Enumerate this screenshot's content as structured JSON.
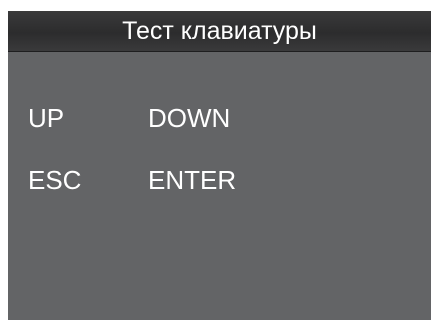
{
  "header": {
    "title": "Тест клавиатуры"
  },
  "keys": [
    {
      "label": "UP"
    },
    {
      "label": "DOWN"
    },
    {
      "label": "ESC"
    },
    {
      "label": "ENTER"
    }
  ],
  "colors": {
    "screen_background": "#636466",
    "title_bar_background": "#2c2c2d",
    "text": "#ffffff"
  }
}
